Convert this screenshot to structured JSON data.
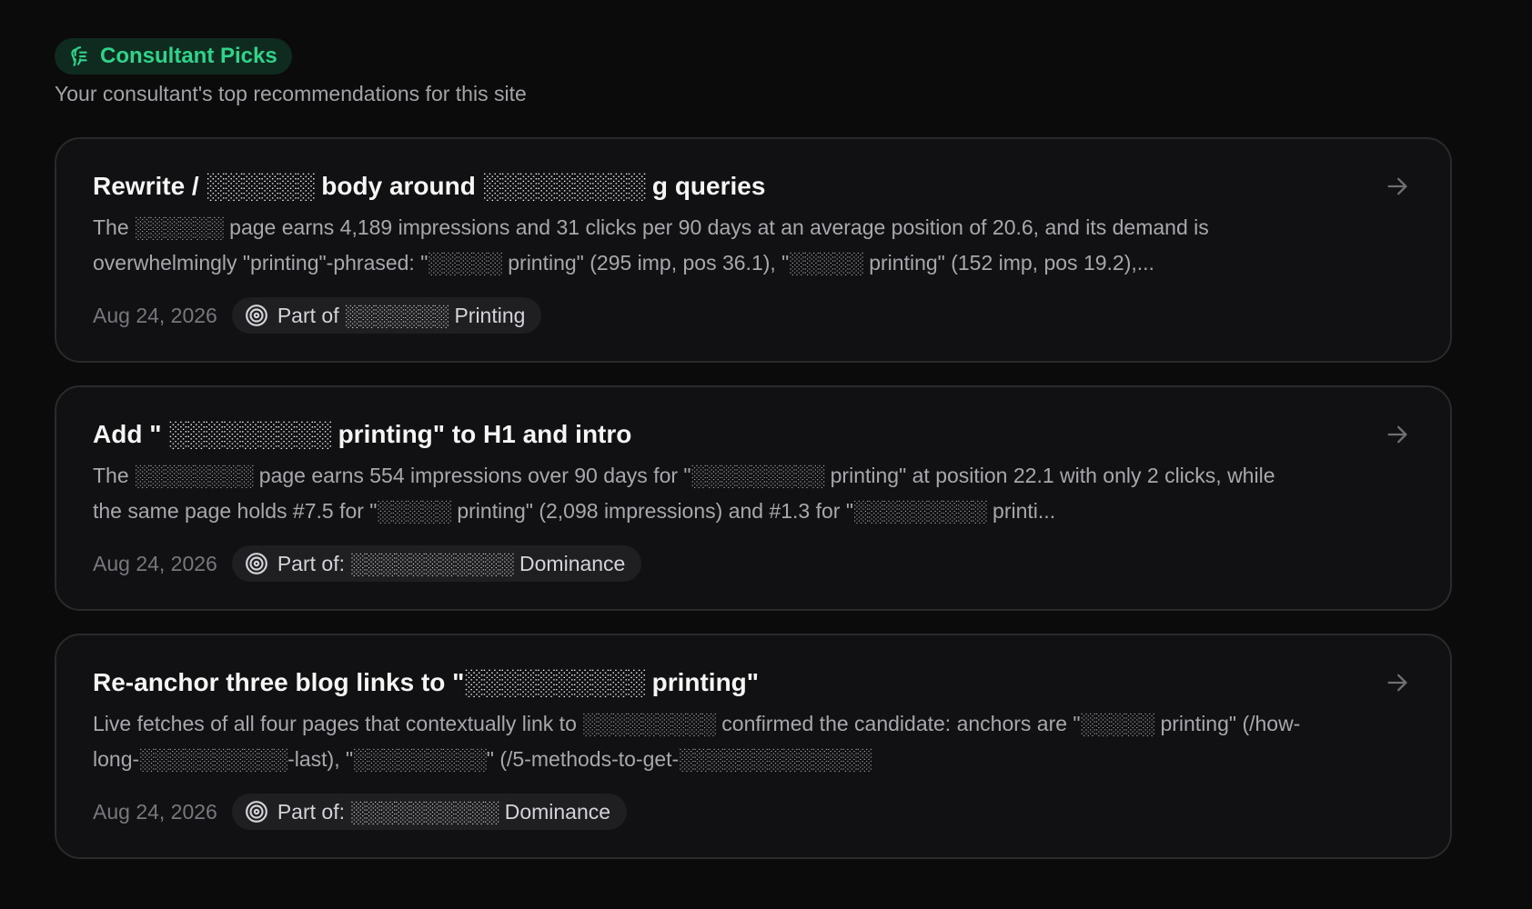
{
  "header": {
    "badge_label": "Consultant Picks",
    "badge_icon": "consultant-picks-icon",
    "subtitle": "Your consultant's top recommendations for this site"
  },
  "colors": {
    "accent": "#2fd38a",
    "background": "#0b0b0c",
    "card_background": "#111113",
    "card_border": "#2a2a2d"
  },
  "cards": [
    {
      "title": "Rewrite / ░░░░░░ body around ░░░░░░░░░ g queries",
      "description": "The ░░░░░░ page earns 4,189 impressions and 31 clicks per 90 days at an average position of 20.6, and its demand is overwhelmingly \"printing\"-phrased: \"░░░░░ printing\" (295 imp, pos 36.1), \"░░░░░ printing\" (152 imp, pos 19.2),...",
      "date": "Aug 24, 2026",
      "part_of": "Part of ░░░░░░░ Printing",
      "pill_icon": "target-icon",
      "arrow_icon": "arrow-right-icon"
    },
    {
      "title": "Add \" ░░░░░░░░░ printing\" to H1 and intro",
      "description": "The ░░░░░░░░ page earns 554 impressions over 90 days for \"░░░░░░░░░ printing\" at position 22.1 with only 2 clicks, while the same page holds #7.5 for \"░░░░░ printing\" (2,098 impressions) and #1.3 for \"░░░░░░░░░ printi...",
      "date": "Aug 24, 2026",
      "part_of": "Part of: ░░░░░░░░░░░ Dominance",
      "pill_icon": "target-icon",
      "arrow_icon": "arrow-right-icon"
    },
    {
      "title": "Re-anchor three blog links to \"░░░░░░░░░░ printing\"",
      "description": "Live fetches of all four pages that contextually link to ░░░░░░░░░ confirmed the candidate: anchors are \"░░░░░ printing\" (/how-long-░░░░░░░░░░-last), \"░░░░░░░░░\" (/5-methods-to-get-░░░░░░░░░░░░░",
      "date": "Aug 24, 2026",
      "part_of": "Part of: ░░░░░░░░░░ Dominance",
      "pill_icon": "target-icon",
      "arrow_icon": "arrow-right-icon"
    }
  ]
}
